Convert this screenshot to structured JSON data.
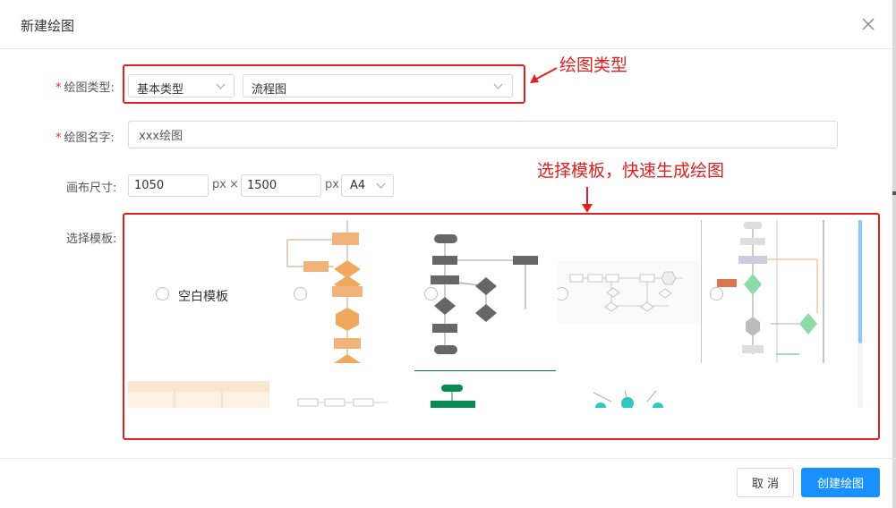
{
  "dialog": {
    "title": "新建绘图"
  },
  "form": {
    "type_label": "绘图类型:",
    "type_category": "基本类型",
    "type_value": "流程图",
    "name_label": "绘图名字:",
    "name_value": "xxx绘图",
    "size_label": "画布尺寸:",
    "width_value": "1050",
    "height_value": "1500",
    "unit_px": "px",
    "times_sign": "×",
    "paper_value": "A4",
    "template_label": "选择模板:"
  },
  "templates": {
    "blank_label": "空白模板",
    "items": [
      {
        "id": "blank"
      },
      {
        "id": "flow-orange"
      },
      {
        "id": "flow-gray"
      },
      {
        "id": "flow-horizontal"
      },
      {
        "id": "flow-swimlane"
      },
      {
        "id": "table-orange"
      },
      {
        "id": "flow-small"
      },
      {
        "id": "tree-green"
      },
      {
        "id": "tree-teal"
      }
    ]
  },
  "annotations": {
    "type_note": "绘图类型",
    "template_note": "选择模板，快速生成绘图"
  },
  "footer": {
    "cancel_label": "取 消",
    "create_label": "创建绘图"
  },
  "colors": {
    "primary": "#1890ff",
    "annotation": "#e02020",
    "required": "#f5222d"
  }
}
